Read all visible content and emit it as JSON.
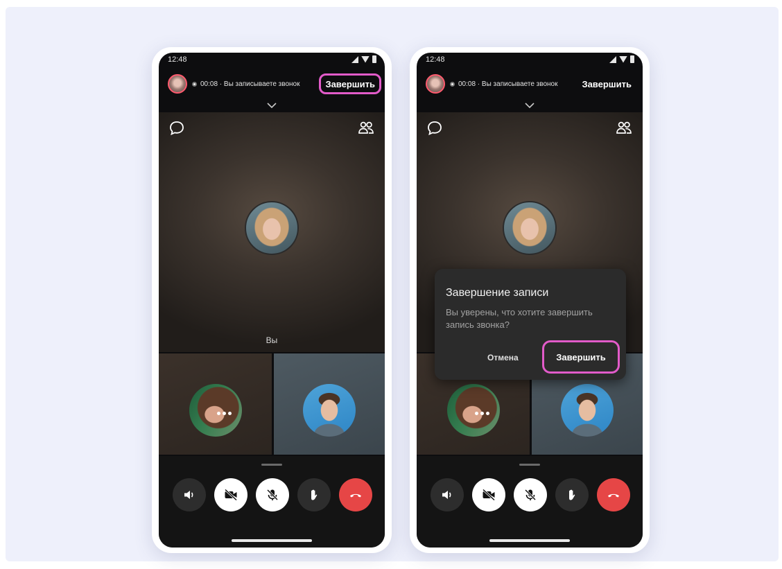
{
  "phones": [
    {
      "status_time": "12:48",
      "recording_text": "00:08 · Вы записываете звонок",
      "end_label": "Завершить",
      "self_label": "Вы"
    },
    {
      "status_time": "12:48",
      "recording_text": "00:08 · Вы записываете звонок",
      "end_label": "Завершить",
      "dialog": {
        "title": "Завершение записи",
        "text": "Вы уверены, что хотите завершить запись звонка?",
        "cancel_label": "Отмена",
        "confirm_label": "Завершить"
      }
    }
  ],
  "icons": [
    "chat-icon",
    "participants-icon",
    "speaker-icon",
    "camera-off-icon",
    "mic-off-icon",
    "raise-hand-icon",
    "hang-up-icon",
    "chevron-down-icon"
  ],
  "colors": {
    "highlight": "#e25bc9",
    "hangup_red": "#e64646",
    "screen_bg": "#0d0d0f",
    "background": "#eef0fb"
  }
}
